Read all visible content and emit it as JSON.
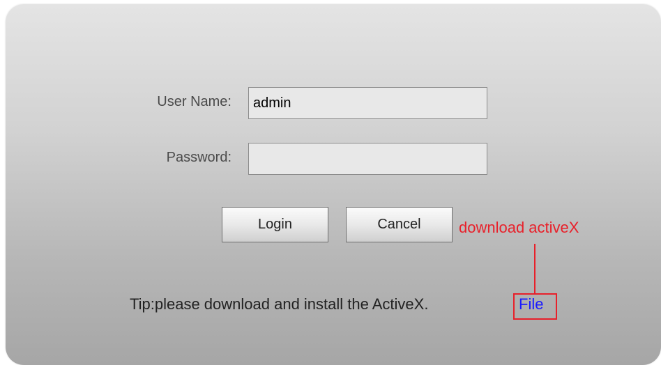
{
  "login_form": {
    "username_label": "User Name:",
    "username_value": "admin",
    "password_label": "Password:",
    "password_value": "",
    "login_button": "Login",
    "cancel_button": "Cancel"
  },
  "tip": {
    "text": "Tip:please download and install the ActiveX.",
    "file_link": "File"
  },
  "annotation": {
    "text": "download activeX",
    "color": "#e8202a"
  }
}
